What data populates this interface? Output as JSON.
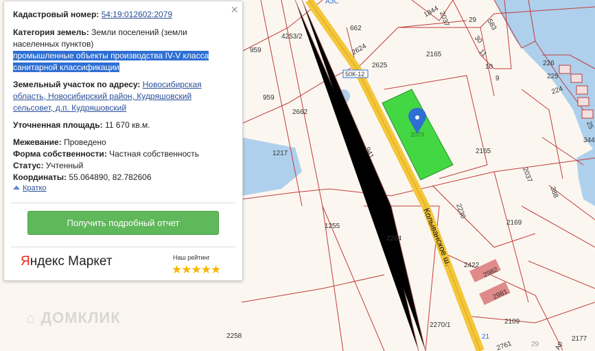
{
  "popup": {
    "cadastral_label": "Кадастровый номер:",
    "cadastral_number": "54:19:012602:2079",
    "category_label": "Категория земель:",
    "category_value_line1": "Земли поселений (земли",
    "category_value_line2": "населенных пунктов)",
    "usage_line1": "промышленные объекты производства IV-V класса",
    "usage_line2": "санитарной классификации",
    "address_label": "Земельный участок по адресу:",
    "address_line1": "Новосибирская",
    "address_line2": "область, Новосибирский район, Кудряшовский",
    "address_line3": "сельсовет, д.п. Кудряшовский",
    "area_label": "Уточненная площадь:",
    "area_value": "11 670 кв.м.",
    "survey_label": "Межевание:",
    "survey_value": "Проведено",
    "ownership_label": "Форма собственности:",
    "ownership_value": "Частная собственность",
    "status_label": "Статус:",
    "status_value": "Учтенный",
    "coords_label": "Координаты:",
    "coords_value": "55.064890, 82.782606",
    "brief_link": "Кратко",
    "report_button": "Получить подробный отчет",
    "market_brand_y": "Я",
    "market_brand_rest": "ндекс Маркет",
    "rating_label": "Наш рейтинг",
    "rating_stars": "★★★★★"
  },
  "map": {
    "road_name": "Колыванское ш.",
    "road_badge": "50К-12",
    "watermark": "ДОМКЛИК",
    "parcels": [
      "4253/2",
      "662",
      "959",
      "2624",
      "2625",
      "2165",
      "959",
      "2662",
      "941",
      "2079",
      "2165",
      "1217",
      "2037",
      "388",
      "1255",
      "2230",
      "2169",
      "2264",
      "2422",
      "2982",
      "2981",
      "2270/1",
      "2109",
      "2258",
      "2177",
      "2761",
      "1844",
      "2037",
      "29",
      "30",
      "11",
      "10",
      "9",
      "583",
      "226",
      "225",
      "224",
      "344",
      "25",
      "АЗС",
      "21",
      "29",
      "Ap"
    ],
    "colors": {
      "water": "#aed0ec",
      "parcel_line": "#c23a3a",
      "selected_parcel": "#43d843",
      "road": "#f4c63a",
      "building": "#e08a8a",
      "marker": "#2f6fd3"
    }
  }
}
